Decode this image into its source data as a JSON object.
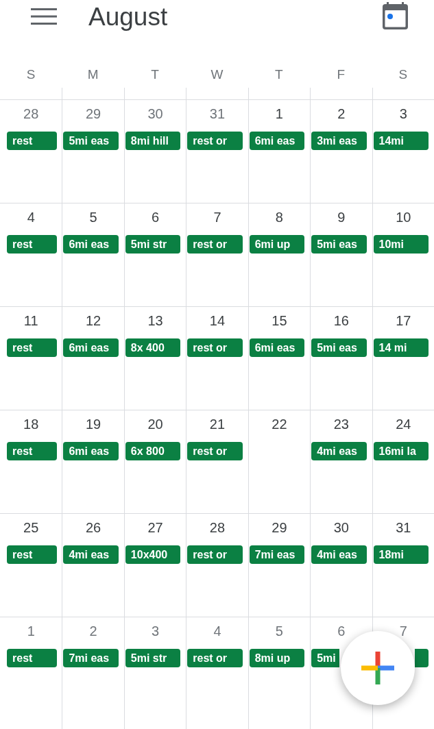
{
  "header": {
    "title": "August"
  },
  "weekdays": [
    "S",
    "M",
    "T",
    "W",
    "T",
    "F",
    "S"
  ],
  "weeks": [
    {
      "days": [
        {
          "date": "28",
          "in_month": false,
          "events": [
            {
              "title": "rest",
              "covered": false
            }
          ]
        },
        {
          "date": "29",
          "in_month": false,
          "events": [
            {
              "title": "5mi eas",
              "covered": false
            }
          ]
        },
        {
          "date": "30",
          "in_month": false,
          "events": [
            {
              "title": "8mi hill",
              "covered": false
            }
          ]
        },
        {
          "date": "31",
          "in_month": false,
          "events": [
            {
              "title": "rest or",
              "covered": false
            }
          ]
        },
        {
          "date": "1",
          "in_month": true,
          "events": [
            {
              "title": "6mi eas",
              "covered": false
            }
          ]
        },
        {
          "date": "2",
          "in_month": true,
          "events": [
            {
              "title": "3mi eas",
              "covered": false
            }
          ]
        },
        {
          "date": "3",
          "in_month": true,
          "events": [
            {
              "title": "14mi",
              "covered": false
            }
          ]
        }
      ]
    },
    {
      "days": [
        {
          "date": "4",
          "in_month": true,
          "events": [
            {
              "title": "rest",
              "covered": false
            }
          ]
        },
        {
          "date": "5",
          "in_month": true,
          "events": [
            {
              "title": "6mi eas",
              "covered": false
            }
          ]
        },
        {
          "date": "6",
          "in_month": true,
          "events": [
            {
              "title": "5mi str",
              "covered": false
            }
          ]
        },
        {
          "date": "7",
          "in_month": true,
          "events": [
            {
              "title": "rest or",
              "covered": false
            }
          ]
        },
        {
          "date": "8",
          "in_month": true,
          "events": [
            {
              "title": "6mi up",
              "covered": false
            }
          ]
        },
        {
          "date": "9",
          "in_month": true,
          "events": [
            {
              "title": "5mi eas",
              "covered": false
            }
          ]
        },
        {
          "date": "10",
          "in_month": true,
          "events": [
            {
              "title": "10mi",
              "covered": false
            }
          ]
        }
      ]
    },
    {
      "days": [
        {
          "date": "11",
          "in_month": true,
          "events": [
            {
              "title": "rest",
              "covered": false
            }
          ]
        },
        {
          "date": "12",
          "in_month": true,
          "events": [
            {
              "title": "6mi eas",
              "covered": false
            }
          ]
        },
        {
          "date": "13",
          "in_month": true,
          "events": [
            {
              "title": "8x 400",
              "covered": false
            }
          ]
        },
        {
          "date": "14",
          "in_month": true,
          "events": [
            {
              "title": "rest or",
              "covered": false
            }
          ]
        },
        {
          "date": "15",
          "in_month": true,
          "events": [
            {
              "title": "6mi eas",
              "covered": false
            }
          ]
        },
        {
          "date": "16",
          "in_month": true,
          "events": [
            {
              "title": "5mi eas",
              "covered": false
            }
          ]
        },
        {
          "date": "17",
          "in_month": true,
          "events": [
            {
              "title": "14 mi",
              "covered": false
            }
          ]
        }
      ]
    },
    {
      "days": [
        {
          "date": "18",
          "in_month": true,
          "events": [
            {
              "title": "rest",
              "covered": false
            }
          ]
        },
        {
          "date": "19",
          "in_month": true,
          "events": [
            {
              "title": "6mi eas",
              "covered": false
            }
          ]
        },
        {
          "date": "20",
          "in_month": true,
          "events": [
            {
              "title": "6x 800",
              "covered": false
            }
          ]
        },
        {
          "date": "21",
          "in_month": true,
          "events": [
            {
              "title": "rest or",
              "covered": false
            }
          ]
        },
        {
          "date": "22",
          "in_month": true
        },
        {
          "date": "23",
          "in_month": true,
          "events": [
            {
              "title": "4mi eas",
              "covered": false
            }
          ]
        },
        {
          "date": "24",
          "in_month": true,
          "events": [
            {
              "title": "16mi la",
              "covered": false
            }
          ]
        }
      ]
    },
    {
      "days": [
        {
          "date": "25",
          "in_month": true,
          "events": [
            {
              "title": "rest",
              "covered": false
            }
          ]
        },
        {
          "date": "26",
          "in_month": true,
          "events": [
            {
              "title": "4mi eas",
              "covered": false
            }
          ]
        },
        {
          "date": "27",
          "in_month": true,
          "events": [
            {
              "title": "10x400",
              "covered": false
            }
          ]
        },
        {
          "date": "28",
          "in_month": true,
          "events": [
            {
              "title": "rest or",
              "covered": false
            }
          ]
        },
        {
          "date": "29",
          "in_month": true,
          "events": [
            {
              "title": "7mi eas",
              "covered": false
            }
          ]
        },
        {
          "date": "30",
          "in_month": true,
          "events": [
            {
              "title": "4mi eas",
              "covered": false
            }
          ]
        },
        {
          "date": "31",
          "in_month": true,
          "events": [
            {
              "title": "18mi",
              "covered": false
            }
          ]
        }
      ]
    },
    {
      "days": [
        {
          "date": "1",
          "in_month": false,
          "events": [
            {
              "title": "rest",
              "covered": false
            }
          ]
        },
        {
          "date": "2",
          "in_month": false,
          "events": [
            {
              "title": "7mi eas",
              "covered": false
            }
          ]
        },
        {
          "date": "3",
          "in_month": false,
          "events": [
            {
              "title": "5mi str",
              "covered": false
            }
          ]
        },
        {
          "date": "4",
          "in_month": false,
          "events": [
            {
              "title": "rest or",
              "covered": false
            }
          ]
        },
        {
          "date": "5",
          "in_month": false,
          "events": [
            {
              "title": "8mi up",
              "covered": false
            }
          ]
        },
        {
          "date": "6",
          "in_month": false,
          "events": [
            {
              "title": "5mi",
              "covered": true
            }
          ]
        },
        {
          "date": "7",
          "in_month": false,
          "events": [
            {
              "covered": true
            }
          ]
        }
      ]
    }
  ]
}
